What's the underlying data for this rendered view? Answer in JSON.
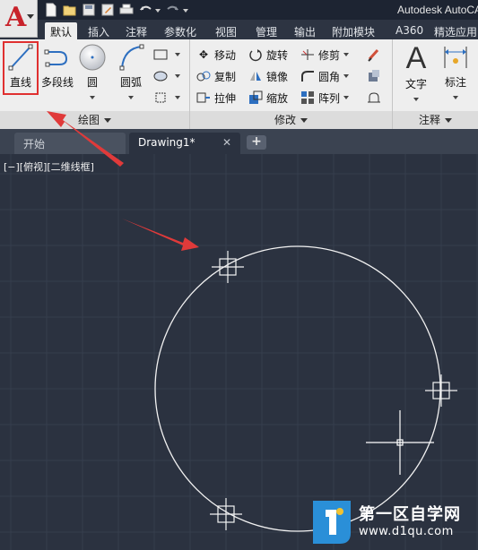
{
  "app": {
    "title": "Autodesk AutoCAD",
    "logo_letter": "A"
  },
  "quick_access": [
    {
      "name": "new-icon"
    },
    {
      "name": "open-icon"
    },
    {
      "name": "save-icon"
    },
    {
      "name": "save-as-icon"
    },
    {
      "name": "print-icon"
    },
    {
      "name": "undo-icon"
    },
    {
      "name": "redo-icon"
    }
  ],
  "ribbon_tabs": [
    {
      "label": "默认",
      "active": true
    },
    {
      "label": "插入"
    },
    {
      "label": "注释"
    },
    {
      "label": "参数化"
    },
    {
      "label": "视图"
    },
    {
      "label": "管理"
    },
    {
      "label": "输出"
    },
    {
      "label": "附加模块"
    },
    {
      "label": "A360"
    },
    {
      "label": "精选应用"
    }
  ],
  "draw_panel": {
    "title": "绘图",
    "line": "直线",
    "polyline": "多段线",
    "circle": "圆",
    "arc": "圆弧"
  },
  "modify_panel": {
    "title": "修改",
    "move": "移动",
    "rotate": "旋转",
    "trim": "修剪",
    "copy": "复制",
    "mirror": "镜像",
    "fillet": "圆角",
    "stretch": "拉伸",
    "scale": "缩放",
    "array": "阵列"
  },
  "annotation_panel": {
    "title": "注释",
    "text": "文字",
    "dimension": "标注"
  },
  "doc_tabs": {
    "start": "开始",
    "drawing": "Drawing1*",
    "close_symbol": "✕",
    "new_symbol": "+"
  },
  "viewport": {
    "label": "[−][俯视][二维线框]"
  },
  "watermark": {
    "name": "第一区自学网",
    "url": "www.d1qu.com"
  },
  "colors": {
    "canvas": "#2b3240",
    "grid": "#363e4d",
    "accent_red": "#e03030",
    "logo_red": "#c8222b"
  }
}
